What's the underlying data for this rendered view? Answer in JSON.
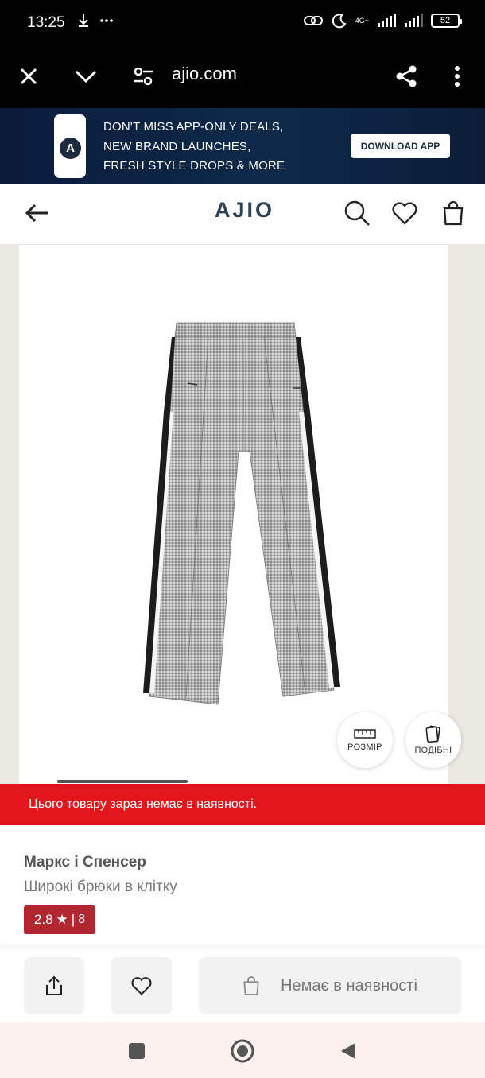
{
  "status_bar": {
    "time": "13:25",
    "network_label": "4G+",
    "battery": "52"
  },
  "browser": {
    "url": "ajio.com"
  },
  "promo": {
    "lines": [
      "DON'T MISS APP-ONLY DEALS,",
      "NEW BRAND LAUNCHES,",
      "FRESH STYLE DROPS & MORE"
    ],
    "button_label": "DOWNLOAD APP",
    "logo_letter": "A"
  },
  "header": {
    "brand": "AJIO"
  },
  "product_actions": {
    "size_label": "РОЗМІР",
    "similar_label": "ПОДІБНІ"
  },
  "out_of_stock_message": "Цього товару зараз немає в наявності.",
  "product": {
    "brand": "Маркс і Спенсер",
    "name": "Широкі брюки в клітку",
    "rating": "2.8",
    "rating_count": "8"
  },
  "bottom_bar": {
    "oos_button_label": "Немає в наявності"
  },
  "colors": {
    "accent_red": "#e3161b",
    "rating_bg": "#b1262f",
    "brand_color": "#2c4152"
  }
}
